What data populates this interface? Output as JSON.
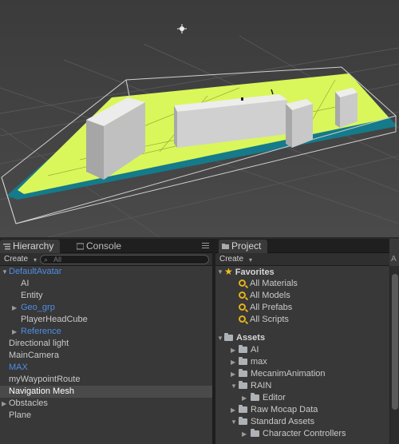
{
  "hierarchy": {
    "tabs": [
      {
        "label": "Hierarchy"
      },
      {
        "label": "Console"
      }
    ],
    "create_label": "Create",
    "search_placeholder": "All",
    "items": [
      {
        "label": "DefaultAvatar",
        "level": 0,
        "blue": true,
        "expanded": true
      },
      {
        "label": "AI",
        "level": 1
      },
      {
        "label": "Entity",
        "level": 1
      },
      {
        "label": "Geo_grp",
        "level": 1,
        "blue": true,
        "collapsed": true
      },
      {
        "label": "PlayerHeadCube",
        "level": 1
      },
      {
        "label": "Reference",
        "level": 1,
        "blue": true,
        "collapsed": true
      },
      {
        "label": "Directional light",
        "level": 0
      },
      {
        "label": "MainCamera",
        "level": 0
      },
      {
        "label": "MAX",
        "level": 0,
        "blue": true
      },
      {
        "label": "myWaypointRoute",
        "level": 0
      },
      {
        "label": "Navigation Mesh",
        "level": 0,
        "selected": true
      },
      {
        "label": "Obstacles",
        "level": 0,
        "collapsed": true
      },
      {
        "label": "Plane",
        "level": 0
      }
    ]
  },
  "project": {
    "tab_label": "Project",
    "create_label": "Create",
    "favorites": {
      "label": "Favorites",
      "items": [
        "All Materials",
        "All Models",
        "All Prefabs",
        "All Scripts"
      ]
    },
    "assets": {
      "label": "Assets",
      "items": [
        {
          "label": "AI",
          "level": 1
        },
        {
          "label": "max",
          "level": 1
        },
        {
          "label": "MecanimAnimation",
          "level": 1
        },
        {
          "label": "RAIN",
          "level": 1,
          "expanded": true
        },
        {
          "label": "Editor",
          "level": 2
        },
        {
          "label": "Raw Mocap Data",
          "level": 1
        },
        {
          "label": "Standard Assets",
          "level": 1,
          "expanded": true
        },
        {
          "label": "Character Controllers",
          "level": 2
        }
      ]
    },
    "right_stub": "A"
  },
  "colors": {
    "navmesh": "#d9f75a",
    "navmesh_edge": "#157a8a",
    "selected_row": "#4a4a4a",
    "blue_text": "#4f8de6"
  }
}
